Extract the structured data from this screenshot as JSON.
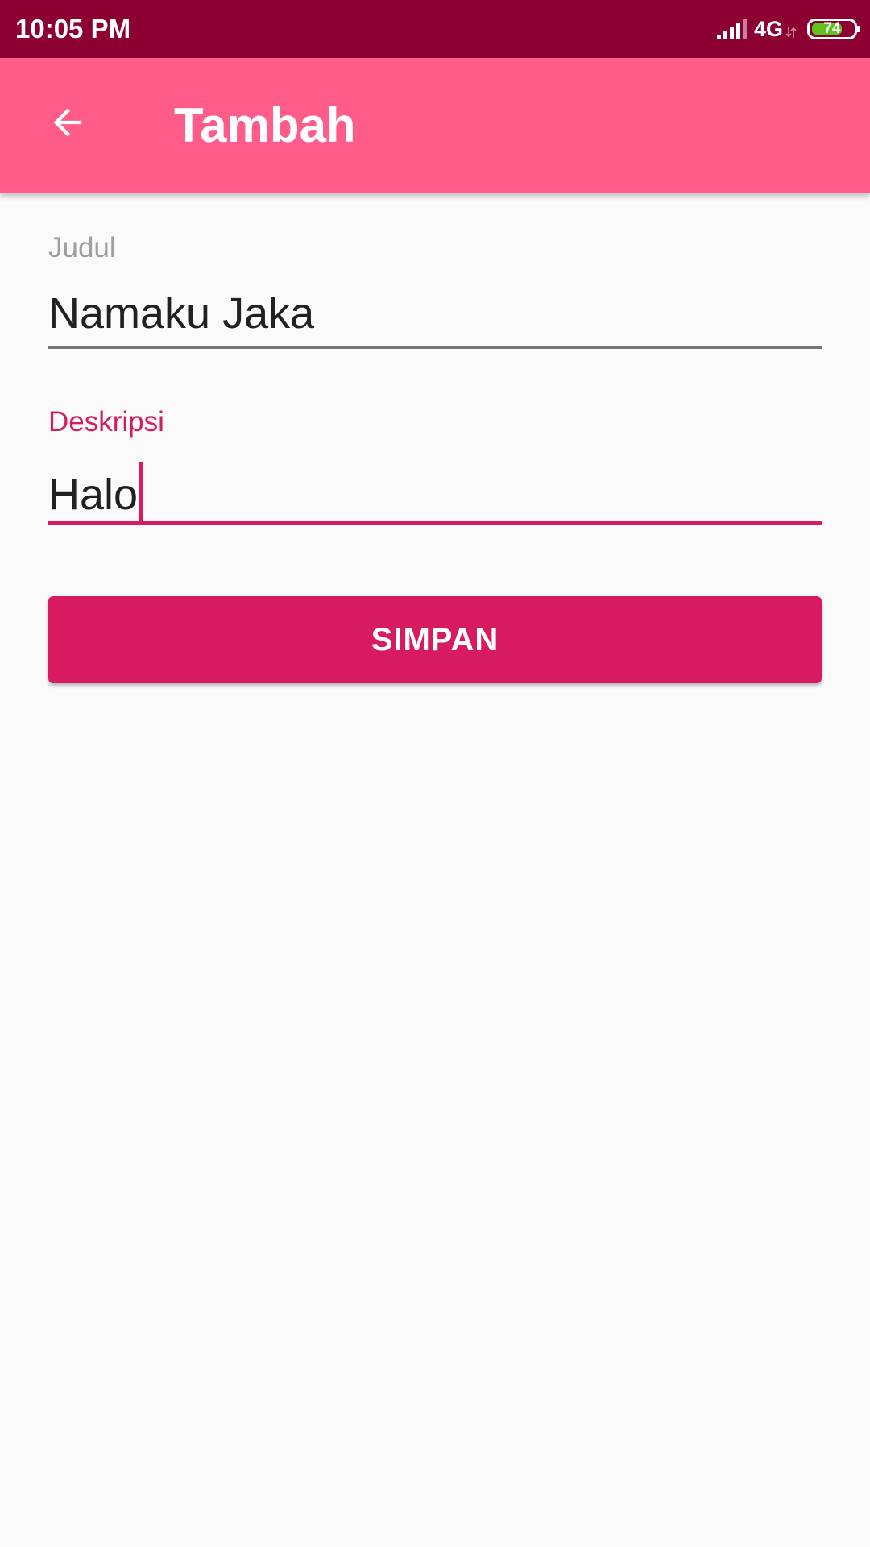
{
  "status_bar": {
    "time": "10:05 PM",
    "network": "4G",
    "battery_level": "74",
    "battery_fraction": 0.74,
    "icons": [
      "signal-icon",
      "data-arrows-icon",
      "battery-icon"
    ]
  },
  "app_bar": {
    "title": "Tambah",
    "back_icon": "arrow-back-icon"
  },
  "form": {
    "judul": {
      "label": "Judul",
      "value": "Namaku Jaka"
    },
    "deskripsi": {
      "label": "Deskripsi",
      "value": "Halo",
      "focused": true
    },
    "save_label": "SIMPAN"
  },
  "colors": {
    "status_bar": "#8c0032",
    "app_bar": "#ff5c8a",
    "accent": "#d81b60",
    "background": "#fafafa",
    "battery_fill": "#5cc41a"
  }
}
